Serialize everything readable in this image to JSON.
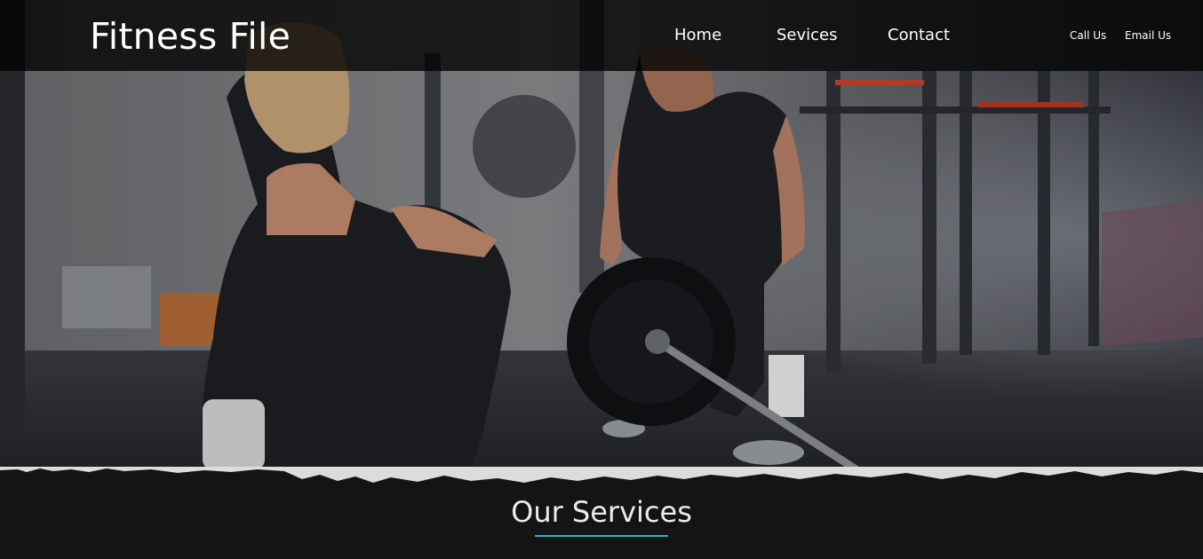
{
  "brand": {
    "name": "Fitness File"
  },
  "nav": {
    "items": [
      {
        "label": "Home"
      },
      {
        "label": "Sevices"
      },
      {
        "label": "Contact"
      }
    ]
  },
  "utility": {
    "call_label": "Call Us",
    "email_label": "Email Us"
  },
  "services": {
    "title": "Our Services"
  },
  "colors": {
    "accent": "#2bb3c6",
    "header_bg": "#000000",
    "section_bg": "#141414"
  }
}
